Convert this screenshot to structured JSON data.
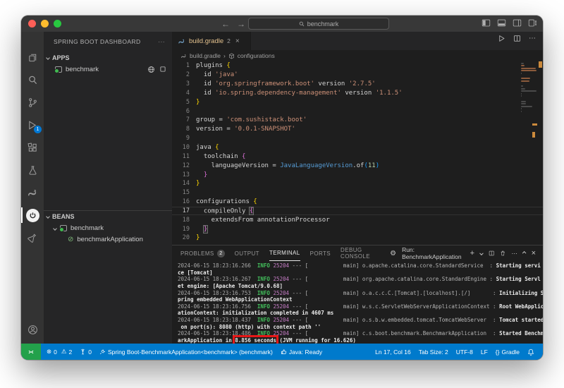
{
  "titlebar": {
    "search_value": "benchmark",
    "traffic": {
      "red": "#ff5f57",
      "yellow": "#febc2e",
      "green": "#28c840"
    },
    "back": "←",
    "forward": "→"
  },
  "sidebar": {
    "title": "SPRING BOOT DASHBOARD",
    "more": "···",
    "apps": {
      "label": "APPS",
      "item": "benchmark"
    },
    "beans": {
      "label": "BEANS",
      "parent": "benchmark",
      "child": "benchmarkApplication"
    }
  },
  "editor": {
    "tab": {
      "label": "build.gradle",
      "badge": "2",
      "close": "×"
    },
    "breadcrumb": {
      "file": "build.gradle",
      "sep": "›",
      "symbol": "configurations"
    },
    "code_lines": [
      {
        "n": 1,
        "segs": [
          {
            "t": "plugins ",
            "c": "fg"
          },
          {
            "t": "{",
            "c": "b1"
          }
        ]
      },
      {
        "n": 2,
        "segs": [
          {
            "t": "  id ",
            "c": "fg"
          },
          {
            "t": "'java'",
            "c": "str"
          }
        ]
      },
      {
        "n": 3,
        "segs": [
          {
            "t": "  id ",
            "c": "fg"
          },
          {
            "t": "'org.springframework.boot'",
            "c": "str"
          },
          {
            "t": " version ",
            "c": "fg"
          },
          {
            "t": "'2.7.5'",
            "c": "str"
          }
        ]
      },
      {
        "n": 4,
        "segs": [
          {
            "t": "  id ",
            "c": "fg"
          },
          {
            "t": "'io.spring.dependency-management'",
            "c": "str"
          },
          {
            "t": " version ",
            "c": "fg"
          },
          {
            "t": "'1.1.5'",
            "c": "str"
          }
        ]
      },
      {
        "n": 5,
        "segs": [
          {
            "t": "}",
            "c": "b1"
          }
        ]
      },
      {
        "n": 6,
        "segs": []
      },
      {
        "n": 7,
        "segs": [
          {
            "t": "group = ",
            "c": "fg"
          },
          {
            "t": "'com.sushistack.boot'",
            "c": "str"
          }
        ]
      },
      {
        "n": 8,
        "segs": [
          {
            "t": "version = ",
            "c": "fg"
          },
          {
            "t": "'0.0.1-SNAPSHOT'",
            "c": "str"
          }
        ]
      },
      {
        "n": 9,
        "segs": []
      },
      {
        "n": 10,
        "segs": [
          {
            "t": "java ",
            "c": "fg"
          },
          {
            "t": "{",
            "c": "b1"
          }
        ]
      },
      {
        "n": 11,
        "segs": [
          {
            "t": "  toolchain ",
            "c": "fg"
          },
          {
            "t": "{",
            "c": "b2"
          }
        ]
      },
      {
        "n": 12,
        "segs": [
          {
            "t": "    languageVersion = ",
            "c": "fg"
          },
          {
            "t": "JavaLanguageVersion",
            "c": "cls"
          },
          {
            "t": ".of",
            "c": "fg"
          },
          {
            "t": "(",
            "c": "b3"
          },
          {
            "t": "11",
            "c": "num"
          },
          {
            "t": ")",
            "c": "b3"
          }
        ]
      },
      {
        "n": 13,
        "segs": [
          {
            "t": "  ",
            "c": "fg"
          },
          {
            "t": "}",
            "c": "b2"
          }
        ]
      },
      {
        "n": 14,
        "segs": [
          {
            "t": "}",
            "c": "b1"
          }
        ]
      },
      {
        "n": 15,
        "segs": []
      },
      {
        "n": 16,
        "segs": [
          {
            "t": "configurations ",
            "c": "fg"
          },
          {
            "t": "{",
            "c": "b1"
          }
        ]
      },
      {
        "n": 17,
        "current": true,
        "cursor": true,
        "segs": [
          {
            "t": "  compileOnly ",
            "c": "fg"
          },
          {
            "t": "{",
            "c": "b2 match"
          }
        ]
      },
      {
        "n": 18,
        "segs": [
          {
            "t": "    extendsFrom annotationProcessor",
            "c": "fg"
          }
        ]
      },
      {
        "n": 19,
        "segs": [
          {
            "t": "  ",
            "c": "fg"
          },
          {
            "t": "}",
            "c": "b2 match"
          }
        ]
      },
      {
        "n": 20,
        "segs": [
          {
            "t": "}",
            "c": "b1"
          }
        ]
      }
    ]
  },
  "panel": {
    "tabs": [
      {
        "label": "PROBLEMS",
        "badge": "2"
      },
      {
        "label": "OUTPUT"
      },
      {
        "label": "TERMINAL"
      },
      {
        "label": "PORTS"
      },
      {
        "label": "DEBUG CONSOLE"
      }
    ],
    "run_label": "Run: BenchmarkApplication",
    "actions": {
      "new": "+",
      "more": "⋯",
      "close": "×"
    },
    "terminal_rows": [
      [
        {
          "t": "2024-06-15 18:23:16.266",
          "c": "ts"
        },
        {
          "t": "  ",
          "c": "def"
        },
        {
          "t": "INFO",
          "c": "info"
        },
        {
          "t": " ",
          "c": "def"
        },
        {
          "t": "25204",
          "c": "pid"
        },
        {
          "t": " --- [           main] ",
          "c": "def"
        },
        {
          "t": "o.apache.catalina.core.StandardService  : ",
          "c": "log"
        },
        {
          "t": "Starting servi",
          "c": "msg"
        }
      ],
      [
        {
          "t": "ce [Tomcat]",
          "c": "msg"
        }
      ],
      [
        {
          "t": "2024-06-15 18:23:16.267",
          "c": "ts"
        },
        {
          "t": "  ",
          "c": "def"
        },
        {
          "t": "INFO",
          "c": "info"
        },
        {
          "t": " ",
          "c": "def"
        },
        {
          "t": "25204",
          "c": "pid"
        },
        {
          "t": " --- [           main] ",
          "c": "def"
        },
        {
          "t": "org.apache.catalina.core.StandardEngine : ",
          "c": "log"
        },
        {
          "t": "Starting Servl",
          "c": "msg"
        }
      ],
      [
        {
          "t": "et engine: [Apache Tomcat/9.0.68]",
          "c": "msg"
        }
      ],
      [
        {
          "t": "2024-06-15 18:23:16.753",
          "c": "ts"
        },
        {
          "t": "  ",
          "c": "def"
        },
        {
          "t": "INFO",
          "c": "info"
        },
        {
          "t": " ",
          "c": "def"
        },
        {
          "t": "25204",
          "c": "pid"
        },
        {
          "t": " --- [           main] ",
          "c": "def"
        },
        {
          "t": "o.a.c.c.C.[Tomcat].[localhost].[/]       : ",
          "c": "log"
        },
        {
          "t": "Initializing S",
          "c": "msg"
        }
      ],
      [
        {
          "t": "pring embedded WebApplicationContext",
          "c": "msg"
        }
      ],
      [
        {
          "t": "2024-06-15 18:23:16.756",
          "c": "ts"
        },
        {
          "t": "  ",
          "c": "def"
        },
        {
          "t": "INFO",
          "c": "info"
        },
        {
          "t": " ",
          "c": "def"
        },
        {
          "t": "25204",
          "c": "pid"
        },
        {
          "t": " --- [           main] ",
          "c": "def"
        },
        {
          "t": "w.s.c.ServletWebServerApplicationContext : ",
          "c": "log"
        },
        {
          "t": "Root WebApplic",
          "c": "msg"
        }
      ],
      [
        {
          "t": "ationContext: initialization completed in 4607 ms",
          "c": "msg"
        }
      ],
      [
        {
          "t": "2024-06-15 18:23:18.437",
          "c": "ts"
        },
        {
          "t": "  ",
          "c": "def"
        },
        {
          "t": "INFO",
          "c": "info"
        },
        {
          "t": " ",
          "c": "def"
        },
        {
          "t": "25204",
          "c": "pid"
        },
        {
          "t": " --- [           main] ",
          "c": "def"
        },
        {
          "t": "o.s.b.w.embedded.tomcat.TomcatWebServer  : ",
          "c": "log"
        },
        {
          "t": "Tomcat started",
          "c": "msg"
        }
      ],
      [
        {
          "t": " on port(s): 8080 (http) with context path ''",
          "c": "msg"
        }
      ],
      [
        {
          "t": "2024-06-15 18:23:18.486",
          "c": "ts"
        },
        {
          "t": "  ",
          "c": "def"
        },
        {
          "t": "INFO",
          "c": "info"
        },
        {
          "t": " ",
          "c": "def"
        },
        {
          "t": "25204",
          "c": "pid"
        },
        {
          "t": " --- [           main] ",
          "c": "def"
        },
        {
          "t": "c.s.boot.benchmark.BenchmarkApplication  : ",
          "c": "log"
        },
        {
          "t": "Started Benchm",
          "c": "msg"
        }
      ],
      [
        {
          "t": "arkApplication in ",
          "c": "msg"
        },
        {
          "t": "8.856 seconds",
          "c": "msg box"
        },
        {
          "t": " (JVM running for 16.626)",
          "c": "msg"
        }
      ]
    ]
  },
  "statusbar": {
    "errors": "0",
    "warnings": "2",
    "ports": "0",
    "debug_session": "Spring Boot-BenchmarkApplication<benchmark> (benchmark)",
    "java_status": "Java: Ready",
    "line_col": "Ln 17, Col 16",
    "tab_size": "Tab Size: 2",
    "encoding": "UTF-8",
    "eol": "LF",
    "lang_icon": "{}",
    "language": "Gradle"
  },
  "colors": {
    "accent": "#007acc",
    "remote_green": "#23a14b",
    "modified_tab": "#e2c08d",
    "annotation_red": "#e51717"
  }
}
